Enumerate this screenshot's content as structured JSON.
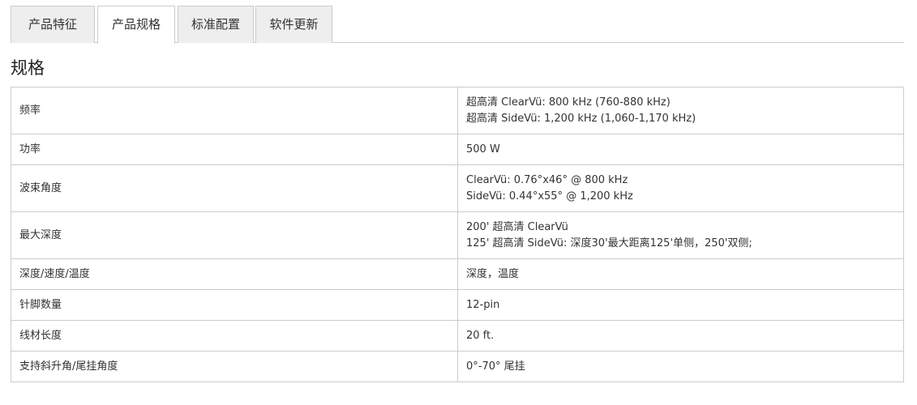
{
  "tabs": [
    {
      "label": "产品特征",
      "active": false
    },
    {
      "label": "产品规格",
      "active": true
    },
    {
      "label": "标准配置",
      "active": false
    },
    {
      "label": "软件更新",
      "active": false
    }
  ],
  "section_title": "规格",
  "specs": [
    {
      "label": "频率",
      "values": [
        "超高清 ClearVü: 800 kHz (760-880 kHz)",
        "超高清 SideVü: 1,200 kHz (1,060-1,170 kHz)"
      ]
    },
    {
      "label": "功率",
      "values": [
        "500 W"
      ]
    },
    {
      "label": "波束角度",
      "values": [
        "ClearVü: 0.76°x46° @ 800 kHz",
        "SideVü: 0.44°x55° @ 1,200 kHz"
      ]
    },
    {
      "label": "最大深度",
      "values": [
        "200' 超高清 ClearVü",
        "125' 超高清 SideVü: 深度30'最大距离125'单侧，250'双侧;"
      ]
    },
    {
      "label": "深度/速度/温度",
      "values": [
        "深度，温度"
      ]
    },
    {
      "label": "针脚数量",
      "values": [
        "12-pin"
      ]
    },
    {
      "label": "线材长度",
      "values": [
        "20 ft."
      ]
    },
    {
      "label": "支持斜升角/尾挂角度",
      "values": [
        "0°-70° 尾挂"
      ]
    }
  ]
}
